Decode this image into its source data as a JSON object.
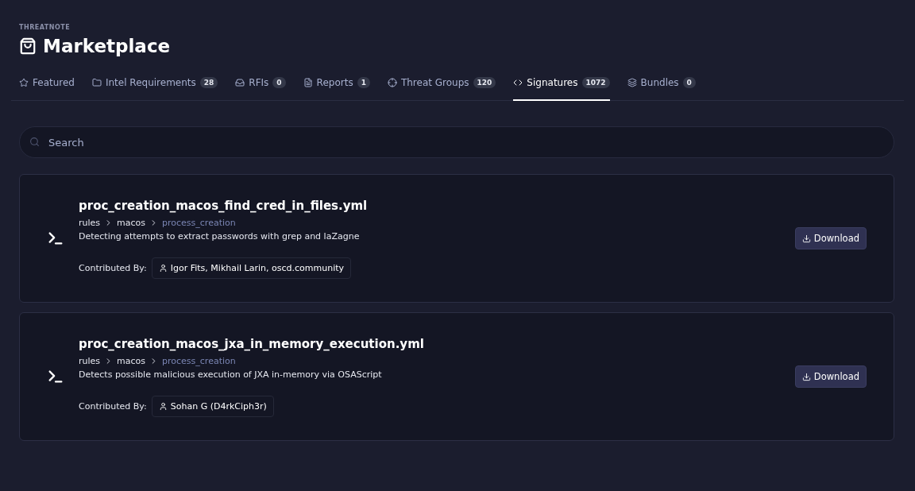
{
  "brand": "THREATNOTE",
  "title": "Marketplace",
  "tabs": [
    {
      "kind": "star",
      "label": "Featured",
      "selected": false
    },
    {
      "kind": "folder",
      "label": "Intel Requirements",
      "count": "28",
      "selected": false
    },
    {
      "kind": "inbox",
      "label": "RFIs",
      "count": "0",
      "selected": false
    },
    {
      "kind": "file",
      "label": "Reports",
      "count": "1",
      "selected": false
    },
    {
      "kind": "target",
      "label": "Threat Groups",
      "count": "120",
      "selected": false
    },
    {
      "kind": "code",
      "label": "Signatures",
      "count": "1072",
      "selected": true
    },
    {
      "kind": "layers",
      "label": "Bundles",
      "count": "0",
      "selected": false
    }
  ],
  "search": {
    "placeholder": "Search"
  },
  "signatures": [
    {
      "name": "proc_creation_macos_find_cred_in_files.yml",
      "path": [
        "rules",
        "macos",
        "process_creation"
      ],
      "description": "Detecting attempts to extract passwords with grep and laZagne",
      "contributed_label": "Contributed By:",
      "contributors": "Igor Fits, Mikhail Larin, oscd.community",
      "action": "Download"
    },
    {
      "name": "proc_creation_macos_jxa_in_memory_execution.yml",
      "path": [
        "rules",
        "macos",
        "process_creation"
      ],
      "description": "Detects possible malicious execution of JXA in-memory via OSAScript",
      "contributed_label": "Contributed By:",
      "contributors": "Sohan G (D4rkCiph3r)",
      "action": "Download"
    }
  ]
}
